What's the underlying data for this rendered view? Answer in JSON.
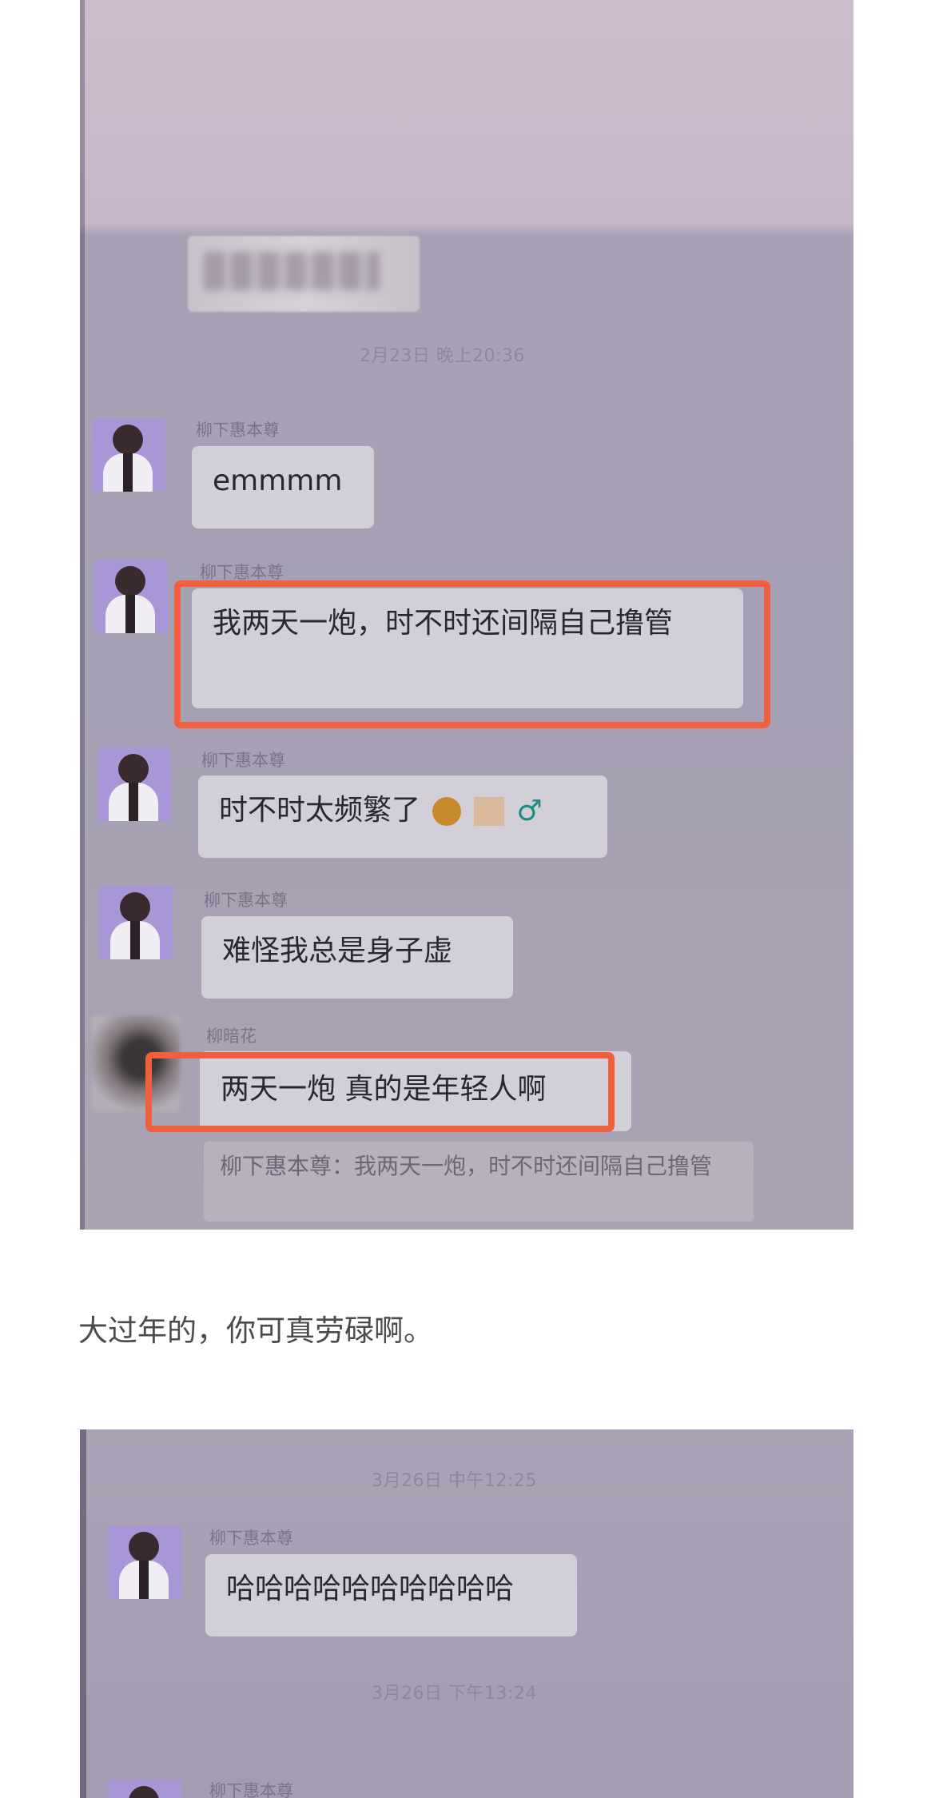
{
  "screenshot1": {
    "timestamp": "2月23日 晚上20:36",
    "messages": [
      {
        "sender": "柳下惠本尊",
        "text": "emmmm"
      },
      {
        "sender": "柳下惠本尊",
        "text": "我两天一炮，时不时还间隔自己撸管"
      },
      {
        "sender": "柳下惠本尊",
        "text": "时不时太频繁了",
        "emoji": [
          "person-gesturing-emoji",
          "skin-tone-emoji",
          "male-sign-emoji"
        ]
      },
      {
        "sender": "柳下惠本尊",
        "text": "难怪我总是身子虚"
      },
      {
        "sender": "柳暗花",
        "text": "两天一炮 真的是年轻人啊"
      }
    ],
    "quote": "柳下惠本尊：我两天一炮，时不时还间隔自己撸管",
    "highlight_color": "#f0603f"
  },
  "caption": "大过年的，你可真劳碌啊。",
  "screenshot2": {
    "timestamp1": "3月26日 中午12:25",
    "messages": [
      {
        "sender": "柳下惠本尊",
        "text": "哈哈哈哈哈哈哈哈哈哈"
      }
    ],
    "timestamp2": "3月26日 下午13:24",
    "partial_sender": "柳下惠本尊"
  }
}
